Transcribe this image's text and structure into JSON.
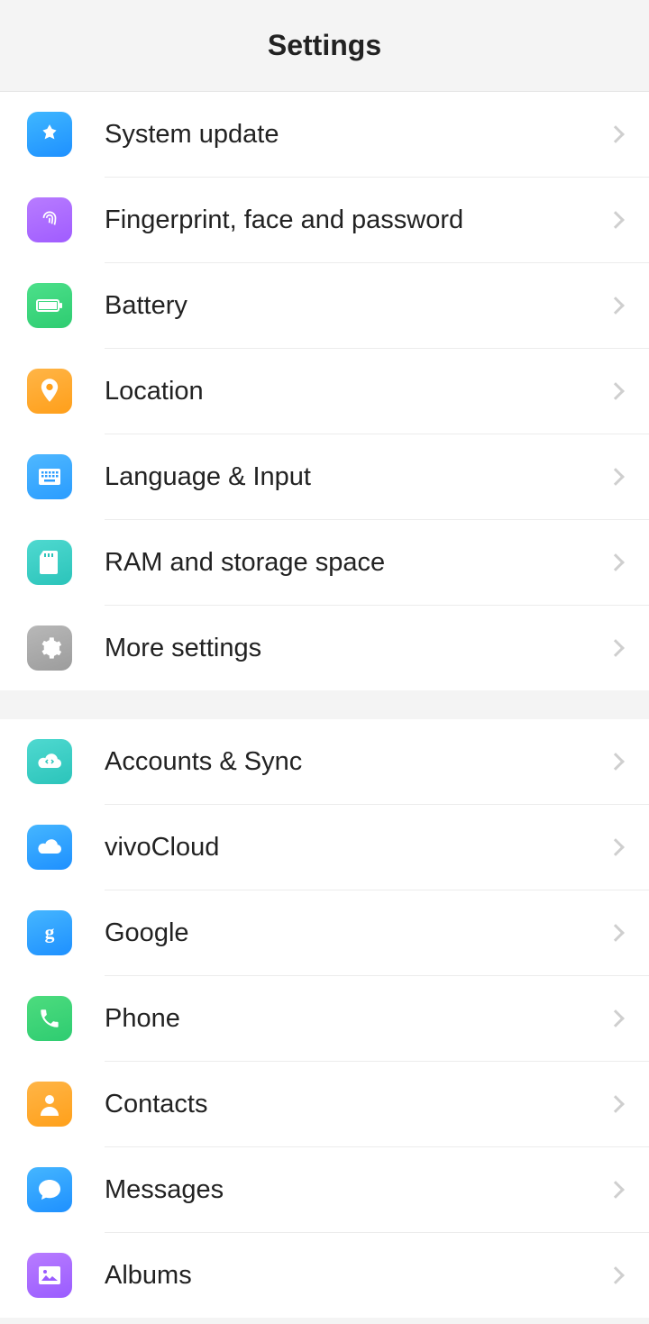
{
  "header": {
    "title": "Settings"
  },
  "groups": [
    {
      "items": [
        {
          "label": "System update"
        },
        {
          "label": "Fingerprint, face and password"
        },
        {
          "label": "Battery"
        },
        {
          "label": "Location"
        },
        {
          "label": "Language & Input"
        },
        {
          "label": "RAM and storage space"
        },
        {
          "label": "More settings"
        }
      ]
    },
    {
      "items": [
        {
          "label": "Accounts & Sync"
        },
        {
          "label": "vivoCloud"
        },
        {
          "label": "Google"
        },
        {
          "label": "Phone"
        },
        {
          "label": "Contacts"
        },
        {
          "label": "Messages"
        },
        {
          "label": "Albums"
        }
      ]
    }
  ]
}
